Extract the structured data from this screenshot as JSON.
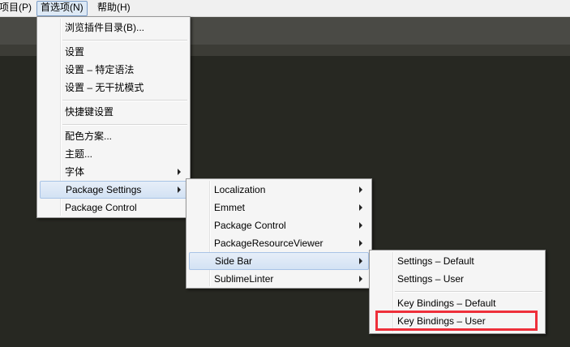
{
  "menubar": {
    "items": [
      {
        "label": "项目(P)"
      },
      {
        "label": "首选项(N)"
      },
      {
        "label": "帮助(H)"
      }
    ]
  },
  "menu_main": {
    "items": [
      {
        "label": "浏览插件目录(B)..."
      },
      {
        "label": "设置"
      },
      {
        "label": "设置 – 特定语法"
      },
      {
        "label": "设置 – 无干扰模式"
      },
      {
        "label": "快捷键设置"
      },
      {
        "label": "配色方案..."
      },
      {
        "label": "主题..."
      },
      {
        "label": "字体"
      },
      {
        "label": "Package Settings"
      },
      {
        "label": "Package Control"
      }
    ]
  },
  "menu_package_settings": {
    "items": [
      {
        "label": "Localization"
      },
      {
        "label": "Emmet"
      },
      {
        "label": "Package Control"
      },
      {
        "label": "PackageResourceViewer"
      },
      {
        "label": "Side Bar"
      },
      {
        "label": "SublimeLinter"
      }
    ]
  },
  "menu_side_bar": {
    "items": [
      {
        "label": "Settings – Default"
      },
      {
        "label": "Settings – User"
      },
      {
        "label": "Key Bindings – Default"
      },
      {
        "label": "Key Bindings – User"
      }
    ]
  },
  "colors": {
    "editor_background": "#272822",
    "highlight_box": "#ee2f3a",
    "menu_background": "#f5f5f5"
  }
}
